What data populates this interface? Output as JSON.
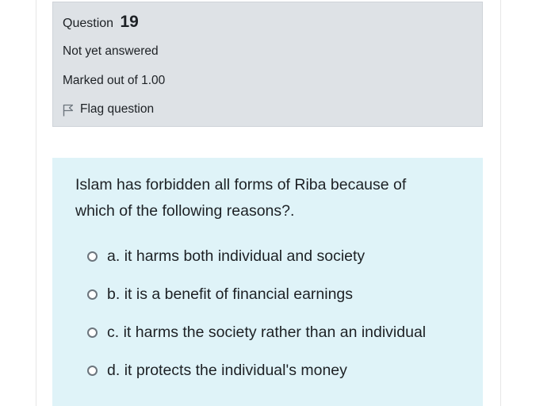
{
  "info": {
    "question_prefix": "Question",
    "question_number": "19",
    "state": "Not yet answered",
    "grade": "Marked out of 1.00",
    "flag_label": "Flag question",
    "flag_icon": "flag-outline-icon"
  },
  "question": {
    "line1": "Islam has forbidden all forms of Riba because of",
    "line2": "which of the following reasons?."
  },
  "options": [
    {
      "letter": "a.",
      "text": "it harms both individual and society"
    },
    {
      "letter": "b.",
      "text": "it is a benefit of financial earnings"
    },
    {
      "letter": "c.",
      "text": "it harms the society rather than an individual"
    },
    {
      "letter": "d.",
      "text": "it protects the individual's money"
    }
  ],
  "colors": {
    "info_bg": "#dee2e6",
    "content_bg": "#dff3f8",
    "text": "#1d2125"
  }
}
